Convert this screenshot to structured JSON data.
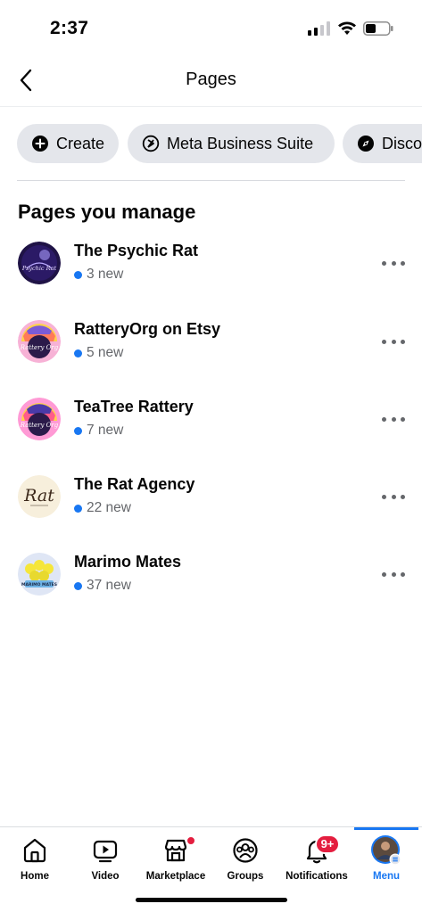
{
  "status_bar": {
    "time": "2:37"
  },
  "header": {
    "title": "Pages"
  },
  "chips": [
    {
      "label": "Create",
      "icon": "plus-circle-icon"
    },
    {
      "label": "Meta Business Suite",
      "icon": "meta-business-suite-icon"
    },
    {
      "label": "Disco",
      "icon": "compass-icon"
    }
  ],
  "section": {
    "title": "Pages you manage"
  },
  "pages": [
    {
      "name": "The Psychic Rat",
      "new_count": "3 new",
      "avatar_text": "Psychic Rat"
    },
    {
      "name": "RatteryOrg on Etsy",
      "new_count": "5 new",
      "avatar_text": "Rattery Org"
    },
    {
      "name": "TeaTree Rattery",
      "new_count": "7 new",
      "avatar_text": "Rattery Org"
    },
    {
      "name": "The Rat Agency",
      "new_count": "22 new",
      "avatar_text": "Rat"
    },
    {
      "name": "Marimo Mates",
      "new_count": "37 new",
      "avatar_text": "MARIMO MATES"
    }
  ],
  "bottom_nav": {
    "items": [
      {
        "label": "Home",
        "icon": "home-icon"
      },
      {
        "label": "Video",
        "icon": "video-icon"
      },
      {
        "label": "Marketplace",
        "icon": "marketplace-icon"
      },
      {
        "label": "Groups",
        "icon": "groups-icon"
      },
      {
        "label": "Notifications",
        "icon": "bell-icon",
        "badge": "9+"
      },
      {
        "label": "Menu",
        "icon": "profile-avatar-icon",
        "active": true
      }
    ]
  },
  "colors": {
    "accent": "#1877f2",
    "badge": "#e41e3f",
    "chip_bg": "#e4e6eb",
    "secondary_text": "#65676b"
  }
}
